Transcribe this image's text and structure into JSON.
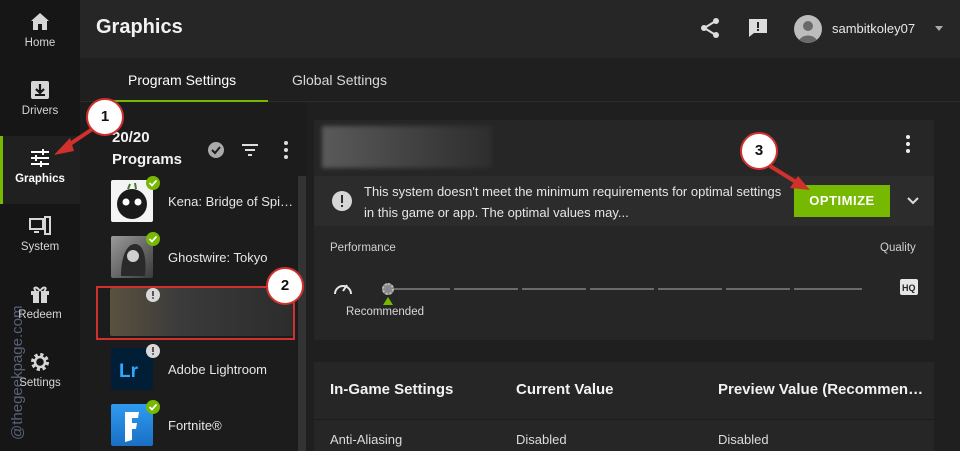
{
  "nav": {
    "items": [
      {
        "label": "Home",
        "icon": "home-icon"
      },
      {
        "label": "Drivers",
        "icon": "download-icon"
      },
      {
        "label": "Graphics",
        "icon": "sliders-icon",
        "active": true
      },
      {
        "label": "System",
        "icon": "computer-icon"
      },
      {
        "label": "Redeem",
        "icon": "gift-icon"
      },
      {
        "label": "Settings",
        "icon": "gear-icon"
      }
    ]
  },
  "header": {
    "title": "Graphics",
    "username": "sambitkoley07"
  },
  "tabs": [
    "Program Settings",
    "Global Settings"
  ],
  "programs": {
    "title": "20/20 Programs",
    "count": "20/20",
    "label": "Programs",
    "items": [
      {
        "name": "Kena: Bridge of Spirits",
        "status": "ok"
      },
      {
        "name": "Ghostwire: Tokyo",
        "status": "ok"
      },
      {
        "name": "",
        "status": "warn",
        "selected": true
      },
      {
        "name": "Adobe Lightroom",
        "status": "warn"
      },
      {
        "name": "Fortnite®",
        "status": "ok"
      }
    ]
  },
  "detail": {
    "warning_text": "This system doesn't meet the minimum requirements for optimal settings in this game or app. The optimal values may...",
    "optimize_label": "OPTIMIZE",
    "performance_label": "Performance",
    "quality_label": "Quality",
    "recommended_label": "Recommended",
    "hq_label": "HQ",
    "slider_level": 0
  },
  "table": {
    "headers": [
      "In-Game Settings",
      "Current Value",
      "Preview Value (Recommended)"
    ],
    "rows": [
      [
        "Anti-Aliasing",
        "Disabled",
        "Disabled"
      ]
    ]
  },
  "annotations": [
    "1",
    "2",
    "3"
  ],
  "watermark": "@thegeekpage.com",
  "colors": {
    "accent": "#76b900",
    "annotation": "#d0312d"
  }
}
